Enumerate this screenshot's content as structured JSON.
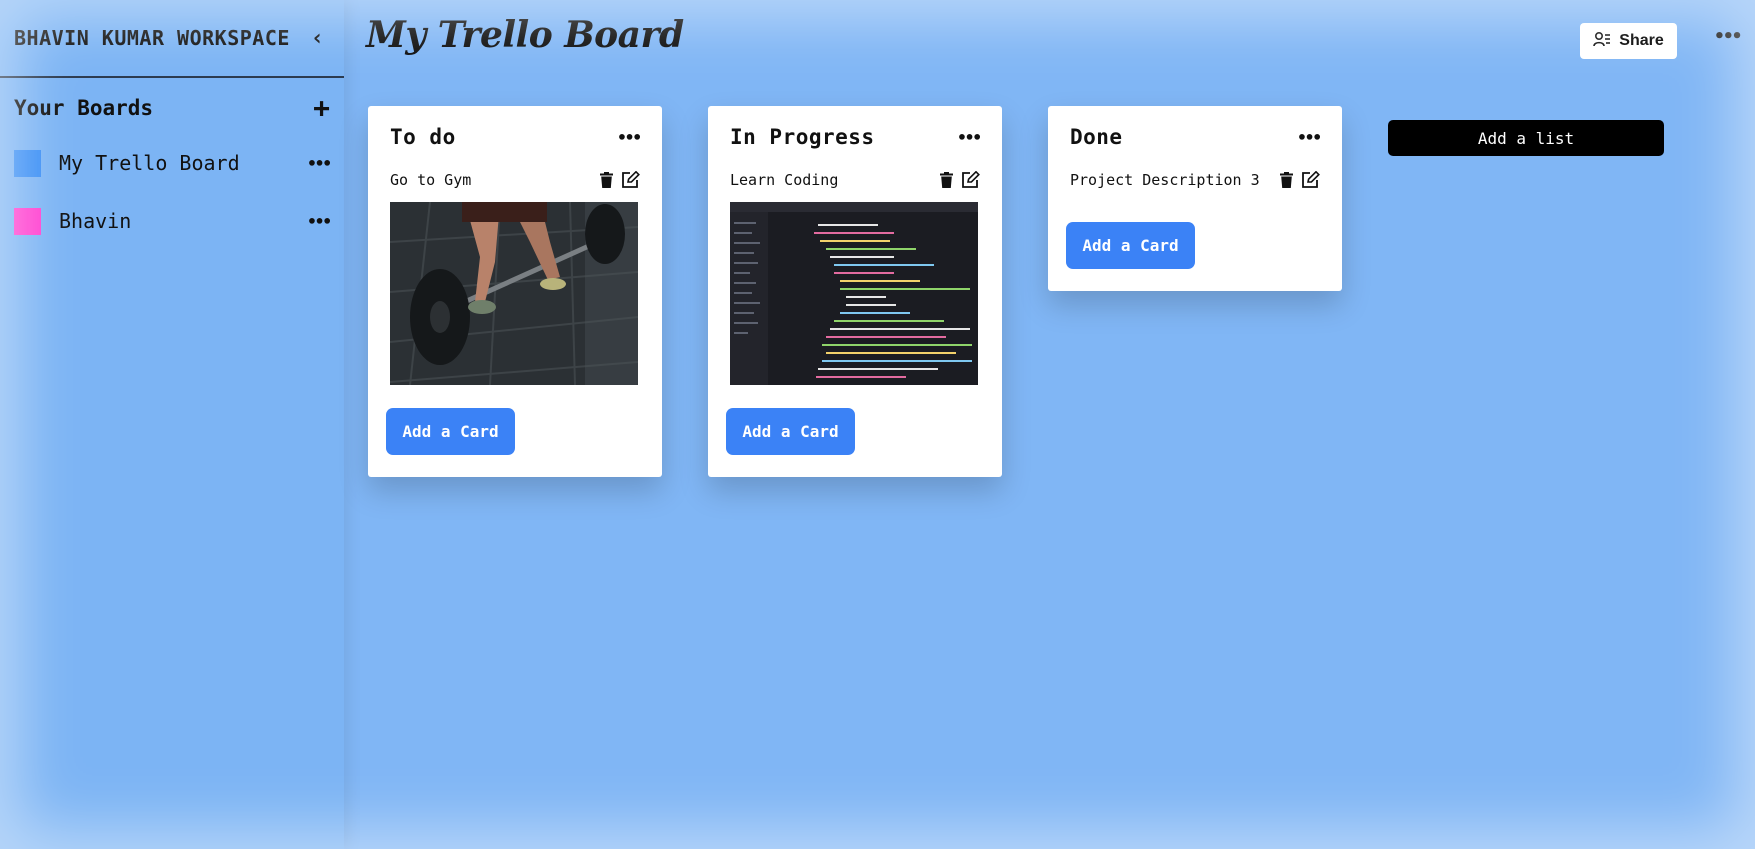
{
  "workspace": {
    "title": "BHAVIN KUMAR WORKSPACE",
    "collapse_icon": "chevron-left-icon"
  },
  "sidebar": {
    "boards_title": "Your Boards",
    "add_icon": "plus-icon",
    "boards": [
      {
        "name": "My Trello Board",
        "color": "#3b8ff5"
      },
      {
        "name": "Bhavin",
        "color": "#ff3fd0"
      }
    ]
  },
  "header": {
    "board_title": "My Trello Board",
    "share_label": "Share",
    "share_icon": "user-share-icon",
    "more_icon": "ellipsis-icon"
  },
  "lists": [
    {
      "title": "To do",
      "cards": [
        {
          "text": "Go to Gym",
          "image": "barbell-deadlift-photo"
        }
      ],
      "add_card_label": "Add a Card"
    },
    {
      "title": "In Progress",
      "cards": [
        {
          "text": "Learn Coding",
          "image": "code-editor-screen-photo"
        }
      ],
      "add_card_label": "Add a Card"
    },
    {
      "title": "Done",
      "cards": [
        {
          "text": "Project Description 3"
        }
      ],
      "add_card_label": "Add a Card"
    }
  ],
  "add_list_label": "Add a list",
  "colors": {
    "background": "#80b6f5",
    "accent_button": "#3b82f6",
    "add_list_button": "#000000"
  }
}
